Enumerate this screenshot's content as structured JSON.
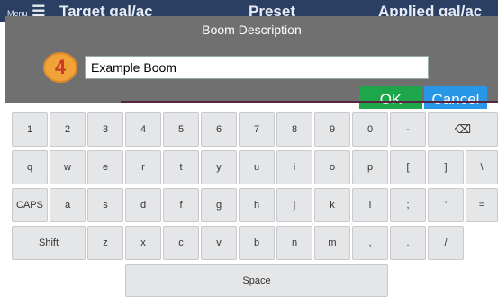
{
  "background_header": {
    "menu_label": "Menu",
    "target": "Target  gal/ac",
    "preset": "Preset",
    "applied": "Applied  gal/ac"
  },
  "dialog": {
    "title": "Boom Description",
    "step_number": "4",
    "input_value": "Example Boom",
    "ok_label": "OK",
    "cancel_label": "Cancel"
  },
  "colors": {
    "dialog_bg": "#707070",
    "ok": "#1ea64a",
    "cancel": "#2897e8",
    "badge": "#f1a33a",
    "key_bg": "#e5e6e8"
  },
  "keyboard": {
    "rows": [
      [
        "1",
        "2",
        "3",
        "4",
        "5",
        "6",
        "7",
        "8",
        "9",
        "0",
        "-",
        "⌫"
      ],
      [
        "q",
        "w",
        "e",
        "r",
        "t",
        "y",
        "u",
        "i",
        "o",
        "p",
        "[",
        "]",
        "\\"
      ],
      [
        "CAPS",
        "a",
        "s",
        "d",
        "f",
        "g",
        "h",
        "j",
        "k",
        "l",
        ";",
        "'",
        "="
      ],
      [
        "Shift",
        "z",
        "x",
        "c",
        "v",
        "b",
        "n",
        "m",
        ",",
        ".",
        "/"
      ],
      [
        "Space"
      ]
    ]
  }
}
